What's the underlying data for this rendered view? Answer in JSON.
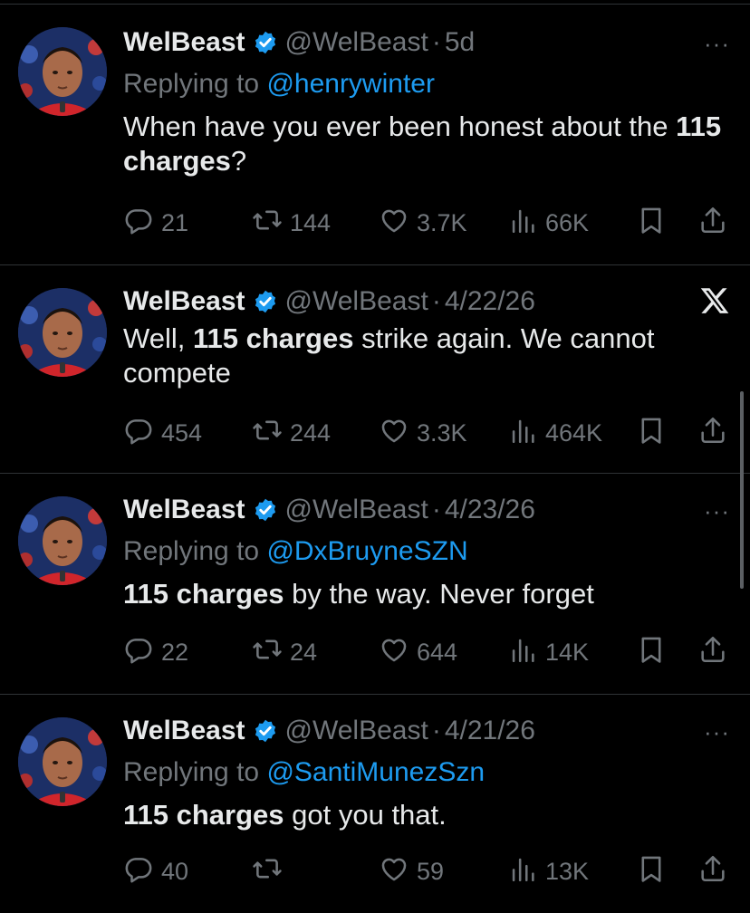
{
  "tweets": [
    {
      "name": "WelBeast",
      "handle": "@WelBeast",
      "separator": "·",
      "time": "5d",
      "reply_prefix": "Replying to ",
      "reply_to": "@henrywinter",
      "text_plain_1": "When have you ever been honest about the ",
      "text_bold": "115 charges",
      "text_plain_2": "?",
      "replies": "21",
      "reposts": "144",
      "likes": "3.7K",
      "views": "66K",
      "corner": "more"
    },
    {
      "name": "WelBeast",
      "handle": "@WelBeast",
      "separator": "·",
      "time": "4/22/26",
      "reply_prefix": "",
      "reply_to": "",
      "text_plain_1": "Well, ",
      "text_bold": "115 charges",
      "text_plain_2": " strike again. We cannot compete",
      "replies": "454",
      "reposts": "244",
      "likes": "3.3K",
      "views": "464K",
      "corner": "x-logo"
    },
    {
      "name": "WelBeast",
      "handle": "@WelBeast",
      "separator": "·",
      "time": "4/23/26",
      "reply_prefix": "Replying to ",
      "reply_to": "@DxBruyneSZN",
      "text_plain_1": "",
      "text_bold": "115 charges",
      "text_plain_2": " by the way. Never forget",
      "replies": "22",
      "reposts": "24",
      "likes": "644",
      "views": "14K",
      "corner": "more"
    },
    {
      "name": "WelBeast",
      "handle": "@WelBeast",
      "separator": "·",
      "time": "4/21/26",
      "reply_prefix": "Replying to ",
      "reply_to": "@SantiMunezSzn",
      "text_plain_1": "",
      "text_bold": "115 charges",
      "text_plain_2": " got you that.",
      "replies": "40",
      "reposts": "",
      "likes": "59",
      "views": "13K",
      "corner": "more"
    }
  ],
  "more_glyph": "···",
  "colors": {
    "background": "#000000",
    "text": "#e7e9ea",
    "muted": "#71767b",
    "link": "#1d9bf0",
    "verified": "#1d9bf0",
    "divider": "#2f3336"
  }
}
